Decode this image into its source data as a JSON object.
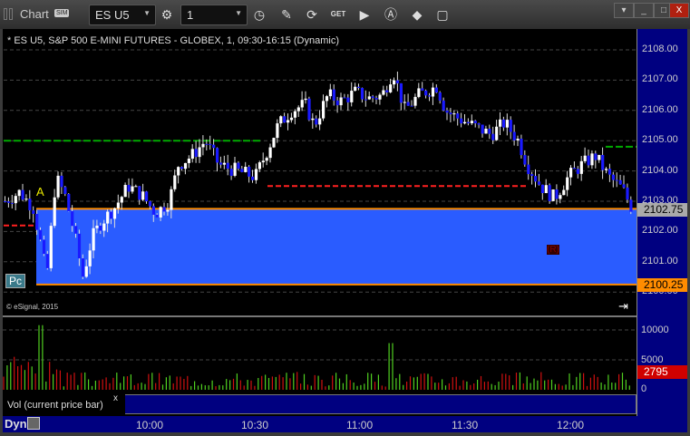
{
  "window": {
    "title": "Chart",
    "sim_badge": "SIM",
    "symbol": "ES U5",
    "interval": "1",
    "buttons": [
      "minimize",
      "restore",
      "close"
    ]
  },
  "toolbar": {
    "icons": [
      "gear-icon",
      "clock-icon",
      "pencil-icon",
      "refresh-icon",
      "get-icon",
      "play-icon",
      "alert-icon",
      "link-icon",
      "note-icon"
    ]
  },
  "chart": {
    "symbol_line": "* ES U5, S&P 500 E-MINI FUTURES - GLOBEX, 1, 09:30-16:15 (Dynamic)",
    "copyright": "© eSignal, 2015",
    "price_labels": [
      "2108.00",
      "2107.00",
      "2106.00",
      "2105.00",
      "2104.00",
      "2103.00",
      "2102.00",
      "2101.00",
      "2100.00"
    ],
    "last_price": "2102.75",
    "range_low": "2100.25",
    "marker_a": "A",
    "marker_pc": "Pc",
    "marker_r": "(R)",
    "range": [
      2100.25,
      2102.75
    ],
    "colors": {
      "up": "#ffffff",
      "down": "#1a1aff",
      "range": "#2a5cff",
      "range_edge": "#ff8c00",
      "green_line": "#00aa00",
      "red_line": "#ff2020"
    },
    "closes": [
      [
        4,
        2103.0
      ],
      [
        20,
        2103.3
      ],
      [
        35,
        2102.8
      ],
      [
        44,
        2101.5
      ],
      [
        50,
        2100.5
      ],
      [
        60,
        2103.8
      ],
      [
        70,
        2103.2
      ],
      [
        80,
        2102
      ],
      [
        90,
        2100.5
      ],
      [
        100,
        2101.8
      ],
      [
        110,
        2102.3
      ],
      [
        125,
        2102.8
      ],
      [
        140,
        2103.5
      ],
      [
        155,
        2103.2
      ],
      [
        170,
        2102.6
      ],
      [
        185,
        2103
      ],
      [
        195,
        2104.2
      ],
      [
        210,
        2104.5
      ],
      [
        225,
        2105
      ],
      [
        240,
        2104.2
      ],
      [
        260,
        2104
      ],
      [
        280,
        2103.8
      ],
      [
        295,
        2104.8
      ],
      [
        305,
        2105.5
      ],
      [
        320,
        2106
      ],
      [
        335,
        2106.2
      ],
      [
        345,
        2105.5
      ],
      [
        360,
        2106.5
      ],
      [
        375,
        2106.3
      ],
      [
        390,
        2106.6
      ],
      [
        405,
        2106.4
      ],
      [
        420,
        2106.5
      ],
      [
        432,
        2107.3
      ],
      [
        445,
        2106
      ],
      [
        460,
        2106.5
      ],
      [
        480,
        2106.8
      ],
      [
        490,
        2106
      ],
      [
        500,
        2105.8
      ],
      [
        520,
        2105.5
      ],
      [
        540,
        2105.2
      ],
      [
        555,
        2105.6
      ],
      [
        570,
        2105
      ],
      [
        580,
        2104.2
      ],
      [
        595,
        2103.5
      ],
      [
        610,
        2103.1
      ],
      [
        625,
        2103.8
      ],
      [
        640,
        2104.2
      ],
      [
        655,
        2104.5
      ],
      [
        670,
        2103.8
      ],
      [
        685,
        2103.4
      ],
      [
        698,
        2102.6
      ]
    ]
  },
  "volume": {
    "title": "Vol (current price bar)",
    "close": "x",
    "labels": [
      "10000",
      "5000",
      "0"
    ],
    "last": "2795"
  },
  "xaxis": {
    "mode": "Dyn",
    "labels": [
      "10:00",
      "10:30",
      "11:00",
      "11:30",
      "12:00"
    ]
  }
}
